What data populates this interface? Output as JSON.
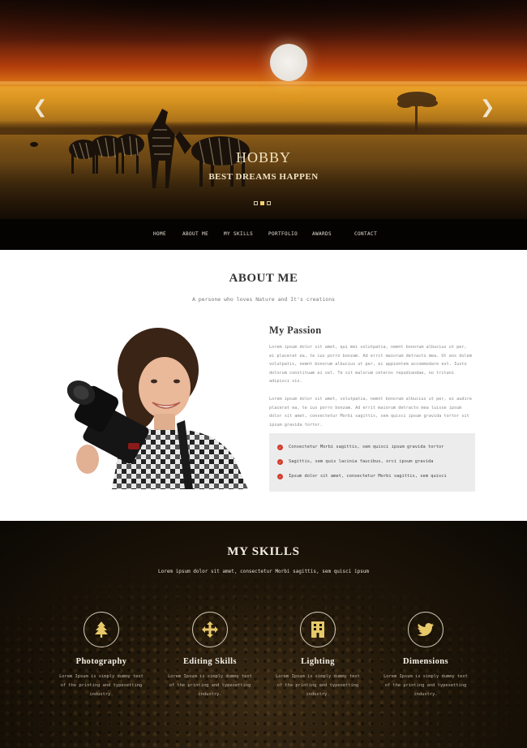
{
  "hero": {
    "title": "HOBBY",
    "subtitle": "BEST DREAMS HAPPEN",
    "prev_arrow": "❮",
    "next_arrow": "❯",
    "slide_count": 3,
    "active_slide": 2
  },
  "nav": {
    "items": [
      "HOME",
      "ABOUT ME",
      "MY SKILLS",
      "PORTFOLIO",
      "AWARDS",
      "CONTACT"
    ]
  },
  "about": {
    "title": "ABOUT ME",
    "tagline": "A persone who loves Nature and It's creations",
    "passion_title": "My Passion",
    "paragraph1": "Lorem ipsum dolor sit amet, qui mei volutpatia, nemnt bonorum albucius ut per, ei placerat ea, te ius porro bonzam. Ad errit maiorum detracto mea. Ut eos dolem volutpatis, nemnt bonorum albucius ut per, ei appientem accommodare est. Iusto dolorum constituam ei vel. Te sit malorum ceteros repudiandae, no tritani adipisci vix.",
    "paragraph2": "Lorem ipsum dolor sit amet, volutpatia, nemnt bonorum albucius ut per, ei audire placerat ea, te ius porro bonzam. Ad errit maiorum detracto mea luisse ipsum dolor sit amet, consectetur Morbi sagittis, sem quisci ipsum gravida tortor sit ipsum gravida tortor.",
    "checklist": [
      "Consectetur Morbi sagittis, sem quisci ipsum gravida tortor",
      "Sagittis, sem quis lacinia faucibus, orci ipsum gravida",
      "Ipsum dolor sit amet, consectetur Morbi sagittis, sem quisci"
    ]
  },
  "skills": {
    "title": "MY SKILLS",
    "subtitle": "Lorem ipsum dolor sit amet, consectetur Morbi sagittis, sem quisci ipsum",
    "items": [
      {
        "name": "Photography",
        "icon": "tree-icon",
        "desc": "Lorem Ipsum is simply dummy text of the printing and typesetting industry."
      },
      {
        "name": "Editing Skills",
        "icon": "move-icon",
        "desc": "Lorem Ipsum is simply dummy text of the printing and typesetting industry."
      },
      {
        "name": "Lighting",
        "icon": "building-icon",
        "desc": "Lorem Ipsum is simply dummy text of the printing and typesetting industry."
      },
      {
        "name": "Dimensions",
        "icon": "twitter-icon",
        "desc": "Lorem Ipsum is simply dummy text of the printing and typesetting industry."
      }
    ]
  },
  "colors": {
    "accent_gold": "#e8c96a",
    "check_red": "#d23a2a",
    "nav_bg": "#050302"
  }
}
